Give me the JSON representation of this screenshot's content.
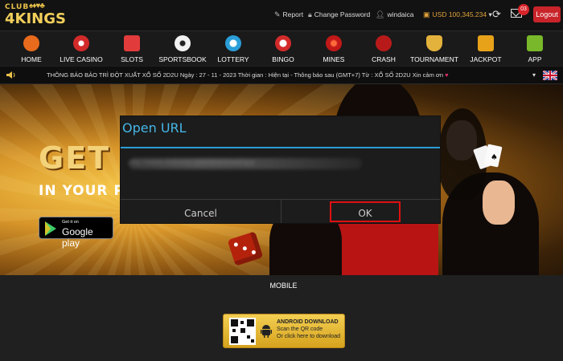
{
  "brand": {
    "logo_top": "CLUB",
    "logo_main": "4KINGS",
    "suits": "♠♦♥♣"
  },
  "header": {
    "report_label": "Report",
    "change_password_label": "Change Password",
    "username": "windaica",
    "balance": "USD 100,345.234",
    "mail_count": "03",
    "logout_label": "Logout"
  },
  "nav": {
    "items": [
      {
        "label": "HOME",
        "icon": "home-icon",
        "color": "#e86a1c"
      },
      {
        "label": "LIVE CASINO",
        "icon": "poker-chip-icon",
        "color": "#d32a2a"
      },
      {
        "label": "SLOTS",
        "icon": "slot-machine-icon",
        "color": "#e23b3b"
      },
      {
        "label": "SPORTSBOOK",
        "icon": "soccer-ball-icon",
        "color": "#f2f2f2"
      },
      {
        "label": "LOTTERY",
        "icon": "lottery-ball-icon",
        "color": "#2a9ed8"
      },
      {
        "label": "BINGO",
        "icon": "bingo-ball-icon",
        "color": "#d32a2a"
      },
      {
        "label": "MINES",
        "icon": "mine-icon",
        "color": "#c21818"
      },
      {
        "label": "CRASH",
        "icon": "rocket-icon",
        "color": "#b81a1a"
      },
      {
        "label": "TOURNAMENT",
        "icon": "trophy-icon",
        "color": "#e3b23c"
      },
      {
        "label": "JACKPOT",
        "icon": "jackpot-777-icon",
        "color": "#e8a21a"
      },
      {
        "label": "APP",
        "icon": "download-arrow-icon",
        "color": "#78b82a"
      }
    ]
  },
  "ticker": {
    "text": "THÔNG BÁO BẢO TRÌ ĐỘT XUẤT XỔ SỐ 2D2U Ngày : 27 - 11 - 2023 Thời gian : Hiện tại - Thông báo sau (GMT+7) Từ : XỔ SỐ 2D2U Xin cảm ơn",
    "heart": "♥"
  },
  "banner": {
    "headline": "GET CI",
    "subline": "IN YOUR PO",
    "gplay_small": "Get it on",
    "gplay_big": "Google play"
  },
  "dialog": {
    "title": "Open URL",
    "url_blurred": "http://www.clubxxxx.com/download/app",
    "cancel_label": "Cancel",
    "ok_label": "OK"
  },
  "mobile": {
    "section_label": "MOBILE",
    "download_title": "ANDROID DOWNLOAD",
    "download_sub1": "Scan the QR code",
    "download_sub2": "Or click here to download"
  },
  "colors": {
    "accent_gold": "#e8c14a",
    "logout_red": "#c8242a",
    "dialog_blue": "#45b6e6",
    "ok_highlight": "#e01010"
  }
}
